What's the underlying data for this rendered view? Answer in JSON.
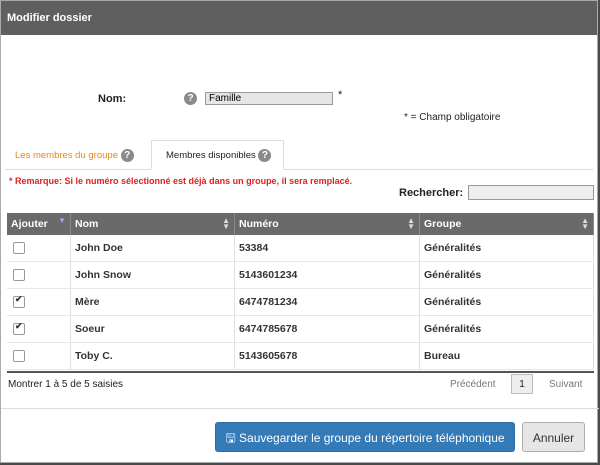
{
  "dialog": {
    "title": "Modifier dossier",
    "name_label": "Nom:",
    "name_value": "Famille",
    "required_star": "*",
    "required_note": "* = Champ obligatoire",
    "help_glyph": "?"
  },
  "tabs": {
    "members": "Les membres du groupe",
    "available": "Membres disponibles"
  },
  "remark": "* Remarque: Si le numéro sélectionné est déjà dans un groupe, il sera remplacé.",
  "search": {
    "label": "Rechercher:",
    "value": ""
  },
  "table": {
    "headers": [
      "Ajouter",
      "Nom",
      "Numéro",
      "Groupe"
    ],
    "rows": [
      {
        "checked": false,
        "name": "John Doe",
        "number": "53384",
        "group": "Généralités"
      },
      {
        "checked": false,
        "name": "John Snow",
        "number": "5143601234",
        "group": "Généralités"
      },
      {
        "checked": true,
        "name": "Mère",
        "number": "6474781234",
        "group": "Généralités"
      },
      {
        "checked": true,
        "name": "Soeur",
        "number": "6474785678",
        "group": "Généralités"
      },
      {
        "checked": false,
        "name": "Toby C.",
        "number": "5143605678",
        "group": "Bureau"
      }
    ]
  },
  "pagination": {
    "info": "Montrer 1 à 5 de 5 saisies",
    "previous": "Précédent",
    "current_page": "1",
    "next": "Suivant"
  },
  "buttons": {
    "save": "Sauvegarder le groupe du répertoire téléphonique",
    "cancel": "Annuler"
  },
  "colors": {
    "titlebar": "#5f5f5f",
    "primary": "#337ab7",
    "remark": "#e02020",
    "tab_inactive": "#e08a1a"
  }
}
